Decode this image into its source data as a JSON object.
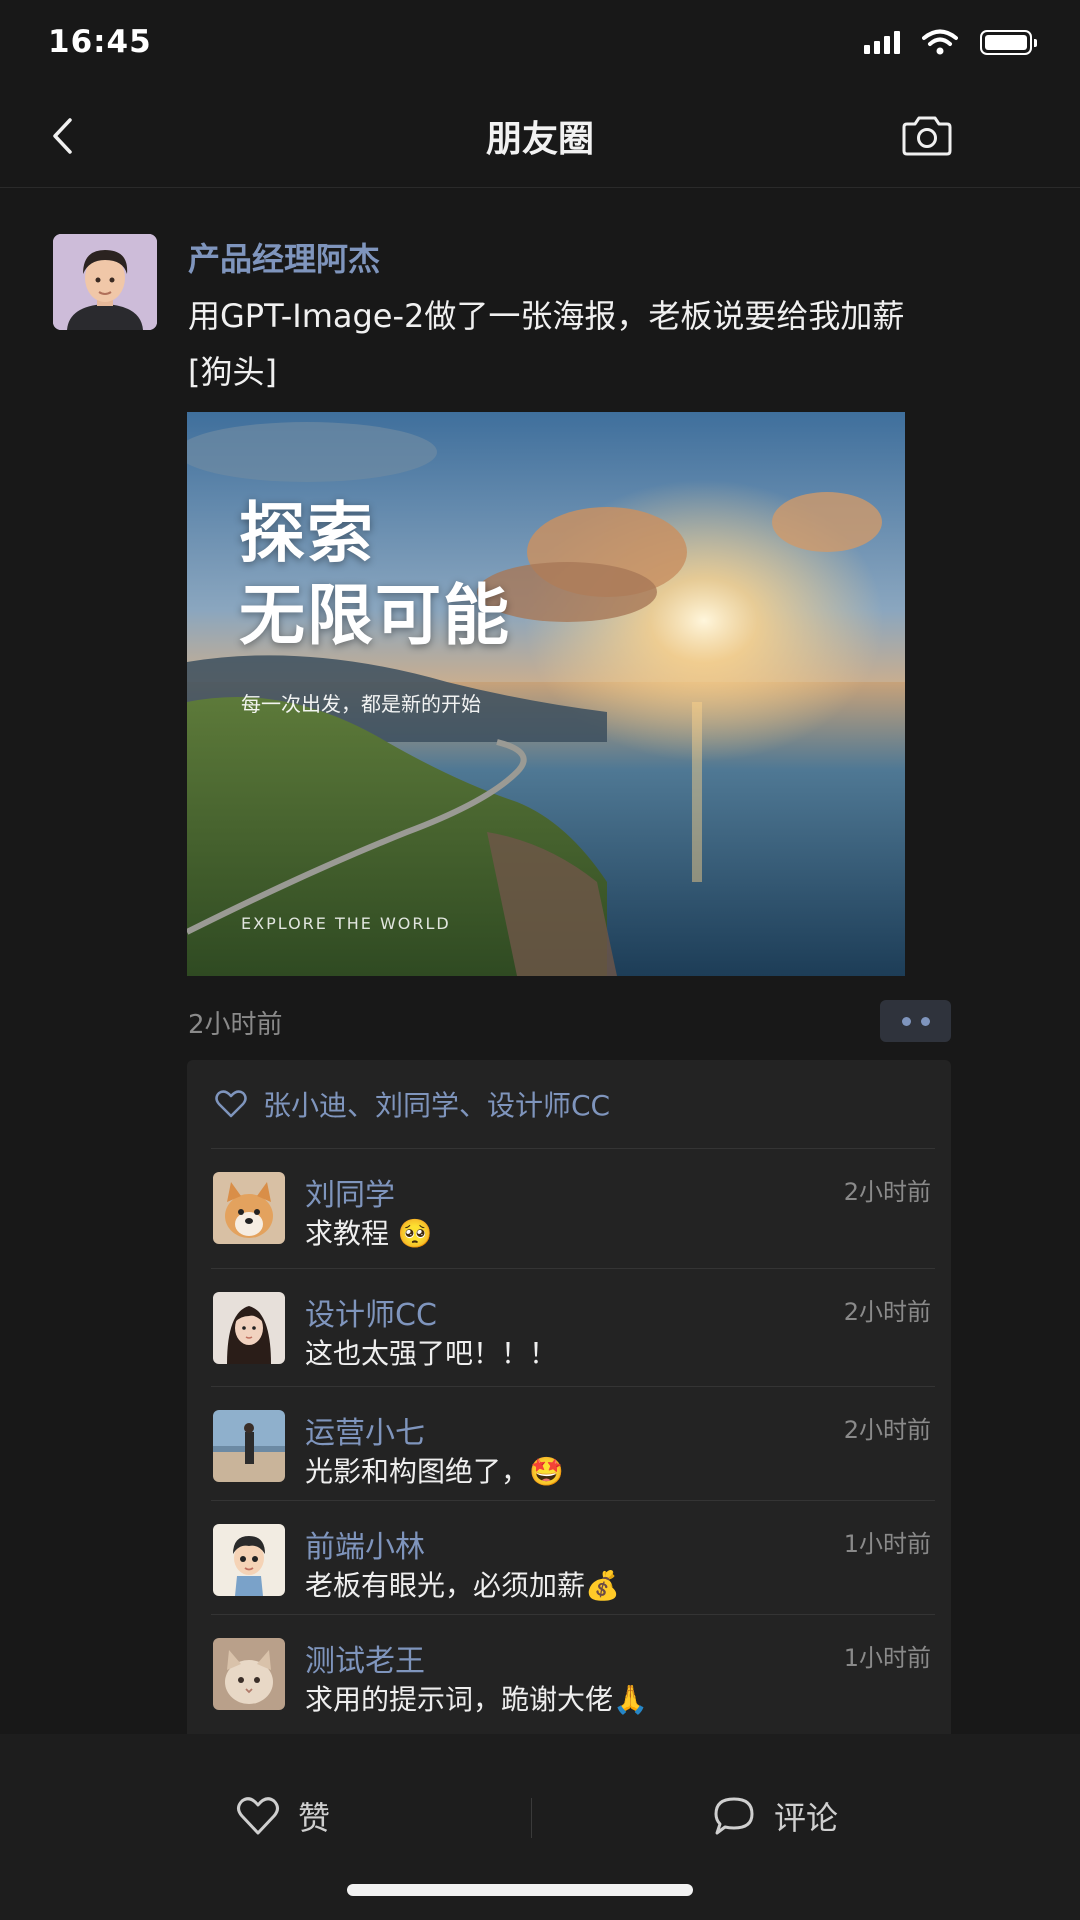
{
  "status_bar": {
    "time": "16:45"
  },
  "nav": {
    "title": "朋友圈"
  },
  "post": {
    "author": "产品经理阿杰",
    "text": "用GPT-Image-2做了一张海报，老板说要给我加薪[狗头]",
    "time": "2小时前",
    "poster": {
      "title_line1": "探索",
      "title_line2": "无限可能",
      "subtitle": "每一次出发，都是新的开始",
      "footer": "EXPLORE THE WORLD"
    }
  },
  "likes": {
    "names": "张小迪、刘同学、设计师CC"
  },
  "comments": [
    {
      "name": "刘同学",
      "text": "求教程 🥺",
      "time": "2小时前"
    },
    {
      "name": "设计师CC",
      "text": "这也太强了吧！！！",
      "time": "2小时前"
    },
    {
      "name": "运营小七",
      "text": "光影和构图绝了，🤩",
      "time": "2小时前"
    },
    {
      "name": "前端小林",
      "text": "老板有眼光，必须加薪💰",
      "time": "1小时前"
    },
    {
      "name": "测试老王",
      "text": "求用的提示词，跪谢大佬🙏",
      "time": "1小时前"
    }
  ],
  "actions": {
    "like_label": "赞",
    "comment_label": "评论"
  },
  "colors": {
    "accent_name": "#7f95bd",
    "background": "#181818",
    "panel": "#232323"
  },
  "icons": [
    "back-chevron-icon",
    "camera-icon",
    "heart-icon",
    "comment-bubble-icon",
    "wifi-icon",
    "battery-icon",
    "signal-icon"
  ]
}
